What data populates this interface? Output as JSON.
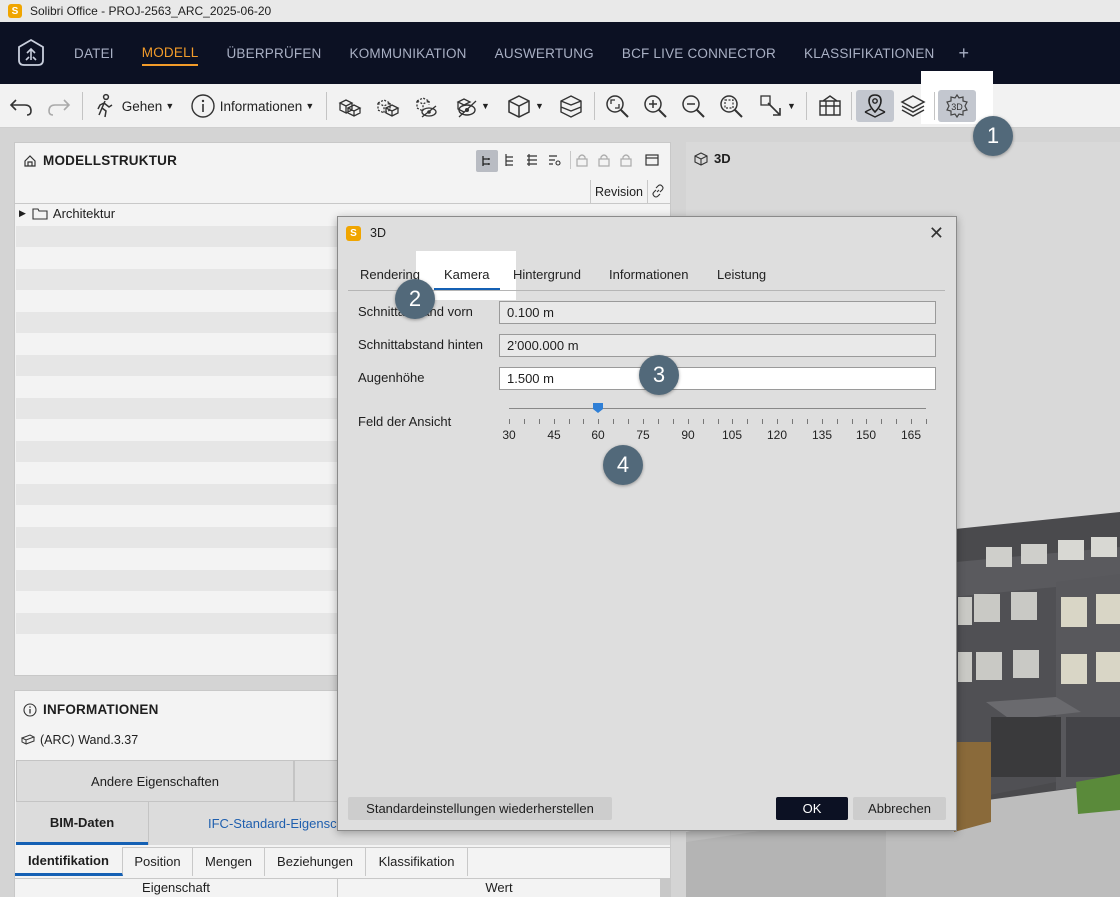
{
  "window": {
    "app_icon": "S",
    "title": "Solibri Office - PROJ-2563_ARC_2025-06-20"
  },
  "menu": {
    "items": [
      "DATEI",
      "MODELL",
      "ÜBERPRÜFEN",
      "KOMMUNIKATION",
      "AUSWERTUNG",
      "BCF LIVE CONNECTOR",
      "KLASSIFIKATIONEN"
    ],
    "active": "MODELL",
    "plus": "+"
  },
  "toolbar": {
    "walk_label": "Gehen",
    "info_label": "Informationen",
    "settings_3d_label": "3D"
  },
  "model_structure": {
    "title": "MODELLSTRUKTUR",
    "column_revision": "Revision",
    "tree_item": "Architektur"
  },
  "info_panel": {
    "title": "INFORMATIONEN",
    "selected": "(ARC) Wand.3.37",
    "other_props": "Andere Eigenschaften",
    "tab_bim": "BIM-Daten",
    "tab_ifc": "IFC-Standard-Eigensch",
    "subtabs": [
      "Identifikation",
      "Position",
      "Mengen",
      "Beziehungen",
      "Klassifikation"
    ],
    "col_property": "Eigenschaft",
    "col_value": "Wert"
  },
  "viewport": {
    "label": "3D"
  },
  "dialog": {
    "icon": "S",
    "title": "3D",
    "close": "✕",
    "tabs": [
      "Rendering",
      "Kamera",
      "Hintergrund",
      "Informationen",
      "Leistung"
    ],
    "active_tab": "Kamera",
    "fields": {
      "clip_front_label": "Schnittabstand vorn",
      "clip_front_value": "0.100 m",
      "clip_back_label": "Schnittabstand hinten",
      "clip_back_value": "2’000.000 m",
      "eye_height_label": "Augenhöhe",
      "eye_height_value": "1.500 m",
      "fov_label": "Feld der Ansicht"
    },
    "slider": {
      "min": 30,
      "max": 170,
      "value": 60,
      "ticks": [
        "30",
        "45",
        "60",
        "75",
        "90",
        "105",
        "120",
        "135",
        "150",
        "165"
      ]
    },
    "restore_btn": "Standardeinstellungen wiederherstellen",
    "ok_btn": "OK",
    "cancel_btn": "Abbrechen"
  },
  "markers": [
    "1",
    "2",
    "3",
    "4"
  ],
  "colors": {
    "accent": "#f39c2a",
    "menubar": "#0c1123",
    "tab_underline": "#1460b4",
    "marker": "#52697a"
  }
}
